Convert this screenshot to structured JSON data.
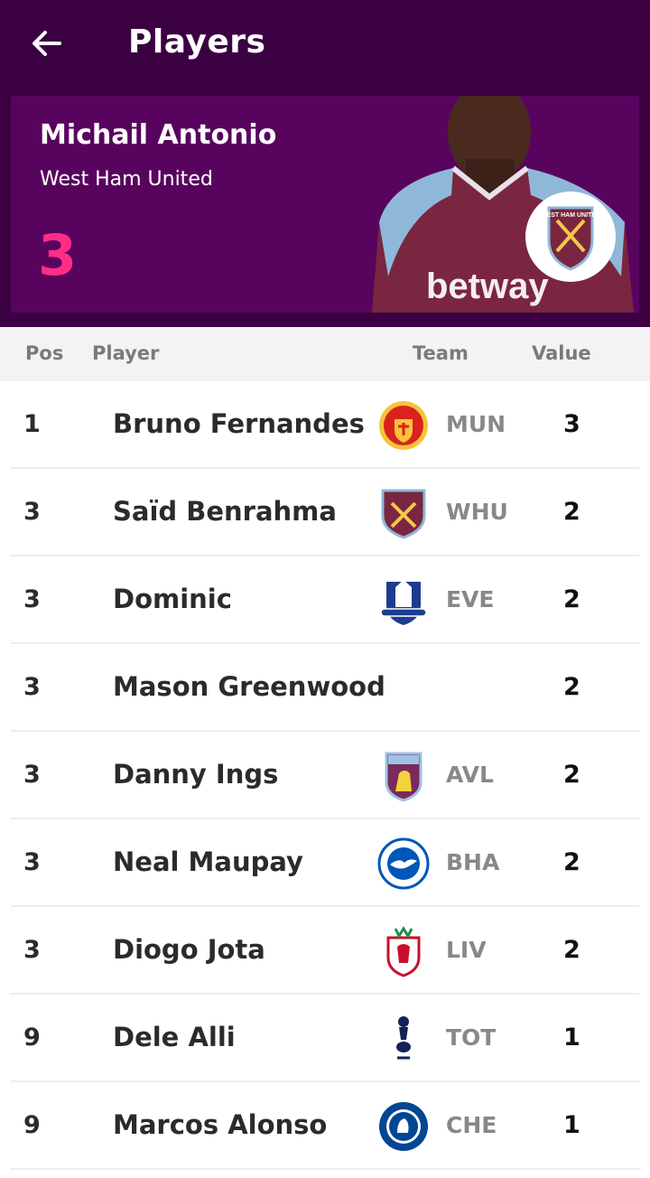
{
  "header": {
    "title": "Players"
  },
  "featured": {
    "name": "Michail Antonio",
    "team": "West Ham United",
    "value": "3",
    "shirt_sponsor": "betway",
    "badge_text": "WEST HAM UNITED"
  },
  "columns": {
    "pos": "Pos",
    "player": "Player",
    "team": "Team",
    "value": "Value"
  },
  "colors": {
    "header_bg": "#3b0042",
    "hero_bg": "#58045f",
    "accent": "#ff2d85"
  },
  "rows": [
    {
      "pos": "1",
      "name": "Bruno Fernandes",
      "team": "MUN",
      "value": "3",
      "crest": "man-utd-crest-icon"
    },
    {
      "pos": "3",
      "name": "Saïd Benrahma",
      "team": "WHU",
      "value": "2",
      "crest": "west-ham-crest-icon"
    },
    {
      "pos": "3",
      "name": "Dominic",
      "team": "EVE",
      "value": "2",
      "crest": "everton-crest-icon"
    },
    {
      "pos": "3",
      "name": "Mason Greenwood",
      "team": "",
      "value": "2",
      "crest": ""
    },
    {
      "pos": "3",
      "name": "Danny Ings",
      "team": "AVL",
      "value": "2",
      "crest": "aston-villa-crest-icon"
    },
    {
      "pos": "3",
      "name": "Neal Maupay",
      "team": "BHA",
      "value": "2",
      "crest": "brighton-crest-icon"
    },
    {
      "pos": "3",
      "name": "Diogo Jota",
      "team": "LIV",
      "value": "2",
      "crest": "liverpool-crest-icon"
    },
    {
      "pos": "9",
      "name": "Dele Alli",
      "team": "TOT",
      "value": "1",
      "crest": "tottenham-crest-icon"
    },
    {
      "pos": "9",
      "name": "Marcos Alonso",
      "team": "CHE",
      "value": "1",
      "crest": "chelsea-crest-icon"
    }
  ]
}
